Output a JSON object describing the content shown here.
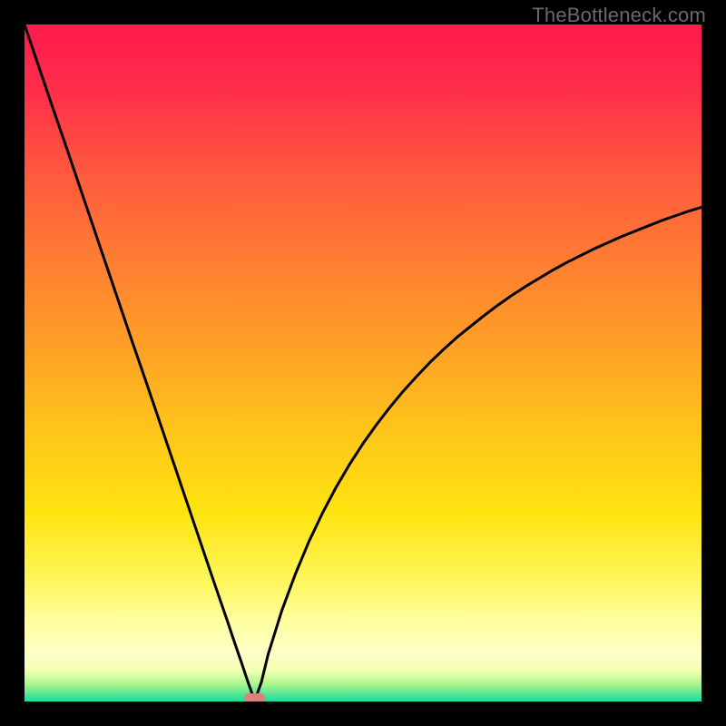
{
  "watermark": "TheBottleneck.com",
  "colors": {
    "page_bg": "#000000",
    "curve": "#000000",
    "marker": "#d9837f"
  },
  "chart_data": {
    "type": "line",
    "title": "",
    "xlabel": "",
    "ylabel": "",
    "xlim": [
      0,
      100
    ],
    "ylim": [
      0,
      100
    ],
    "grid": false,
    "legend": false,
    "x": [
      0,
      2,
      4,
      6,
      8,
      10,
      12,
      14,
      16,
      18,
      20,
      22,
      24,
      26,
      28,
      30,
      31,
      32,
      33,
      33.5,
      34,
      34.5,
      35,
      36,
      38,
      40,
      42,
      44,
      46,
      48,
      50,
      52,
      54,
      56,
      58,
      60,
      62,
      64,
      66,
      68,
      70,
      72,
      74,
      76,
      78,
      80,
      82,
      84,
      86,
      88,
      90,
      92,
      94,
      96,
      98,
      100
    ],
    "values": [
      100,
      94.1,
      88.2,
      82.4,
      76.5,
      70.6,
      64.7,
      58.8,
      52.9,
      47.1,
      41.2,
      35.3,
      29.4,
      23.5,
      17.6,
      11.8,
      8.8,
      5.9,
      2.9,
      1.5,
      0,
      1.5,
      2.9,
      7.0,
      13.4,
      18.8,
      23.6,
      27.8,
      31.6,
      35.0,
      38.1,
      40.9,
      43.5,
      45.9,
      48.1,
      50.2,
      52.1,
      53.9,
      55.5,
      57.1,
      58.6,
      60.0,
      61.3,
      62.5,
      63.7,
      64.8,
      65.8,
      66.8,
      67.7,
      68.6,
      69.4,
      70.2,
      71.0,
      71.7,
      72.4,
      73.0
    ],
    "minimum": {
      "x": 34,
      "y": 0
    },
    "marker": {
      "x": 34,
      "y": 0.5,
      "width_x_units": 3.2,
      "height_y_units": 1.4
    },
    "gradient_stops": [
      {
        "offset": 0.0,
        "color": "#ff1a4d"
      },
      {
        "offset": 0.1,
        "color": "#ff2f49"
      },
      {
        "offset": 0.22,
        "color": "#ff593e"
      },
      {
        "offset": 0.35,
        "color": "#ff7e33"
      },
      {
        "offset": 0.48,
        "color": "#ffa126"
      },
      {
        "offset": 0.6,
        "color": "#ffc51a"
      },
      {
        "offset": 0.72,
        "color": "#ffe40f"
      },
      {
        "offset": 0.82,
        "color": "#fff65a"
      },
      {
        "offset": 0.88,
        "color": "#ffff9e"
      },
      {
        "offset": 0.93,
        "color": "#ffffc8"
      },
      {
        "offset": 0.955,
        "color": "#f1ffb0"
      },
      {
        "offset": 0.975,
        "color": "#a9f58e"
      },
      {
        "offset": 0.99,
        "color": "#4ee594"
      },
      {
        "offset": 1.0,
        "color": "#17e0a4"
      }
    ]
  }
}
